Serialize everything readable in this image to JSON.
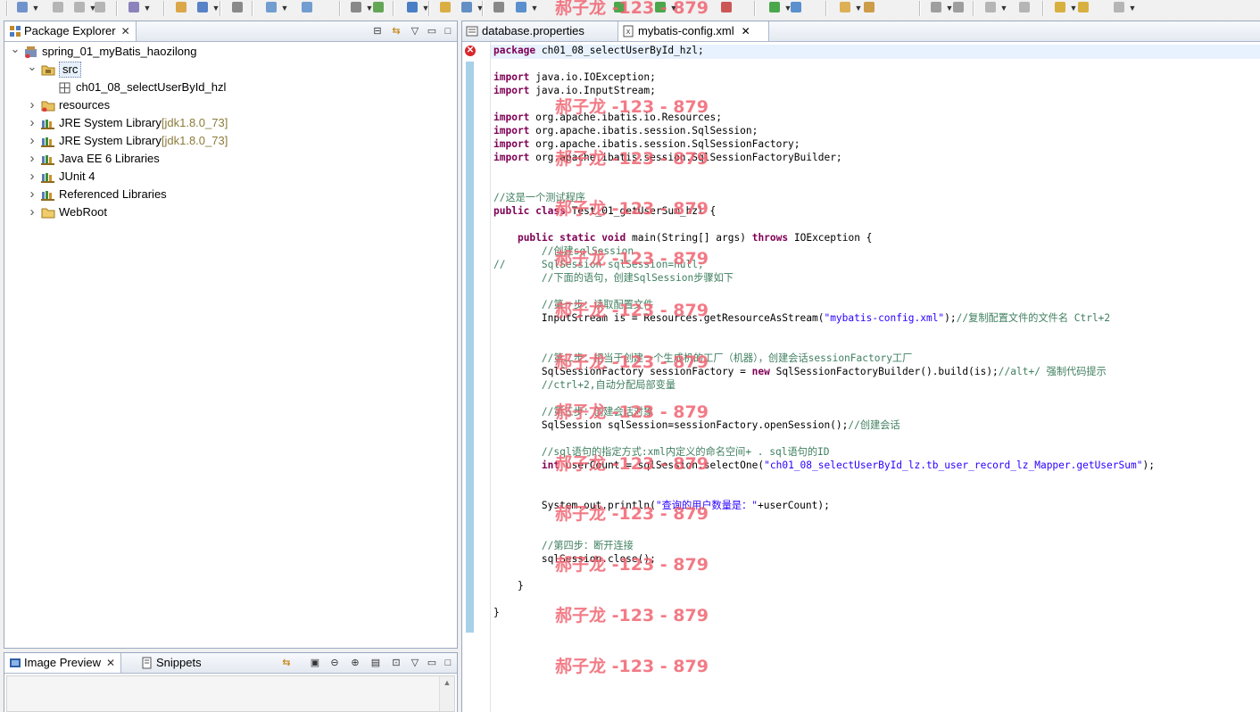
{
  "toolbar": {
    "icons": [
      "new-icon",
      "save-icon",
      "save-all-icon",
      "print-icon",
      "new-wizard-icon",
      "package-icon",
      "cube-icon",
      "build-icon",
      "debug-icon",
      "search-icon",
      "open-type-icon",
      "deploy-icon",
      "globe-icon",
      "open-folder-icon",
      "run-server-icon",
      "server-icon",
      "web-icon",
      "run-icon",
      "run-debug-icon",
      "refresh-icon",
      "coverage-icon",
      "edit-icon",
      "mark-icon",
      "back-icon",
      "forward-icon"
    ]
  },
  "package_explorer": {
    "title": "Package Explorer",
    "tree": [
      {
        "label": "spring_01_myBatis_haozilong",
        "decor": "",
        "icon": "project-icon",
        "expanded": true,
        "depth": 0
      },
      {
        "label": "src",
        "decor": "",
        "icon": "source-folder-icon",
        "expanded": true,
        "depth": 1,
        "selected": true
      },
      {
        "label": "ch01_08_selectUserById_hzl",
        "decor": "",
        "icon": "package-icon",
        "depth": 2
      },
      {
        "label": "resources",
        "decor": "",
        "icon": "source-folder-error-icon",
        "expanded": false,
        "depth": 1
      },
      {
        "label": "JRE System Library",
        "decor": "[jdk1.8.0_73]",
        "icon": "library-icon",
        "expanded": false,
        "depth": 1
      },
      {
        "label": "JRE System Library",
        "decor": "[jdk1.8.0_73]",
        "icon": "library-icon",
        "expanded": false,
        "depth": 1
      },
      {
        "label": "Java EE 6 Libraries",
        "decor": "",
        "icon": "library-icon",
        "expanded": false,
        "depth": 1
      },
      {
        "label": "JUnit 4",
        "decor": "",
        "icon": "library-icon",
        "expanded": false,
        "depth": 1
      },
      {
        "label": "Referenced Libraries",
        "decor": "",
        "icon": "library-icon",
        "expanded": false,
        "depth": 1
      },
      {
        "label": "WebRoot",
        "decor": "",
        "icon": "folder-icon",
        "expanded": false,
        "depth": 1
      }
    ]
  },
  "bottom_views": {
    "image_preview": "Image Preview",
    "snippets": "Snippets"
  },
  "editor": {
    "tabs": [
      {
        "label": "database.properties",
        "active": false
      },
      {
        "label": "mybatis-config.xml",
        "active": true
      }
    ],
    "lines": [
      "package ch01_08_selectUserById_hzl;",
      "",
      "import java.io.IOException;",
      "import java.io.InputStream;",
      "",
      "import org.apache.ibatis.io.Resources;",
      "import org.apache.ibatis.session.SqlSession;",
      "import org.apache.ibatis.session.SqlSessionFactory;",
      "import org.apache.ibatis.session.SqlSessionFactoryBuilder;",
      "",
      "",
      "//这是一个测试程序",
      "public class Test_01_getUserSum_hzl {",
      "",
      "    public static void main(String[] args) throws IOException {",
      "        //创建sqlSession",
      "//      SqlSession sqlSession=null;",
      "        //下面的语句，创建SqlSession步骤如下",
      "",
      "        //第一步：读取配置文件",
      "        InputStream is = Resources.getResourceAsStream(\"mybatis-config.xml\");//复制配置文件的文件名 Ctrl+2",
      "",
      "",
      "        //第二步：相当于创建一个生成机的工厂（机器），创建会话sessionFactory工厂",
      "        SqlSessionFactory sessionFactory = new SqlSessionFactoryBuilder().build(is);//alt+/ 强制代码提示",
      "        //ctrl+2,自动分配局部变量",
      "",
      "        //第三步：创建会话对象",
      "        SqlSession sqlSession=sessionFactory.openSession();//创建会话",
      "",
      "        //sql语句的指定方式:xml内定义的命名空间+ . sql语句的ID",
      "        int userCount = sqlSession.selectOne(\"ch01_08_selectUserById_lz.tb_user_record_lz_Mapper.getUserSum\");",
      "",
      "",
      "        System.out.println(\"查询的用户数量是：\"+userCount);",
      "",
      "",
      "        //第四步：断开连接",
      "        sqlSession.close();",
      "",
      "    }",
      "",
      "}"
    ]
  },
  "watermark": "郝子龙 -123 - 879",
  "colors": {
    "keyword": "#7f0055",
    "comment": "#3f7f5f",
    "string": "#2a00ff",
    "watermark": "#f06472",
    "error": "#d8262b"
  }
}
